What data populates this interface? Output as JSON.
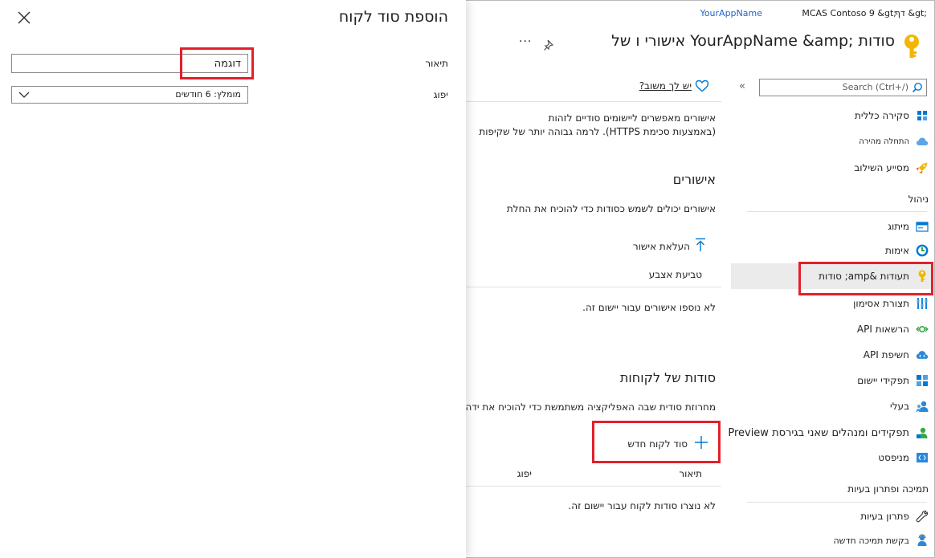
{
  "breadcrumb": {
    "item1": "דף &gt;",
    "item2": "MCAS Contoso 9 &gt;",
    "item3": "YourAppName"
  },
  "page": {
    "title": "אישורי ו של YourAppName &amp; סודות",
    "more_label": "..."
  },
  "search": {
    "placeholder": "Search (Ctrl+/)"
  },
  "feedback": {
    "label": "יש לך משוב?"
  },
  "sidebar": {
    "items": [
      {
        "label": "סקירה כללית",
        "icon": "grid-icon"
      },
      {
        "label": "התחלה מהירה",
        "icon": "cloud-icon"
      },
      {
        "label": "מסייע השילוב",
        "icon": "rocket-icon"
      }
    ],
    "section_manage": "ניהול",
    "manage_items": [
      {
        "label": "מיתוג",
        "icon": "branding-icon"
      },
      {
        "label": "אימות",
        "icon": "authentication-icon"
      },
      {
        "label": "תעודות &amp; סודות",
        "icon": "key-icon"
      },
      {
        "label": "תצורת אסימון",
        "icon": "token-icon"
      },
      {
        "label": "הרשאות API",
        "icon": "api-permissions-icon"
      },
      {
        "label": "חשיפת API",
        "icon": "cloud-api-icon"
      },
      {
        "label": "תפקידי יישום",
        "icon": "app-roles-icon"
      },
      {
        "label": "בעלי",
        "icon": "owners-icon"
      },
      {
        "label": "תפקידים ומנהלים שאני בגירסת Preview",
        "icon": "roles-admins-icon"
      },
      {
        "label": "מניפסט",
        "icon": "manifest-icon"
      }
    ],
    "section_support": "תמיכה ופתרון בעיות",
    "support_items": [
      {
        "label": "פתרון בעיות",
        "icon": "wrench-icon"
      },
      {
        "label": "בקשת תמיכה חדשה",
        "icon": "support-person-icon"
      }
    ]
  },
  "intro": {
    "line1": "אישורים מאפשרים ליישומים סודיים לזהות",
    "line2": "(באמצעות סכימת HTTPS). לרמה גבוהה יותר של שקיפות"
  },
  "certificates": {
    "heading": "אישורים",
    "description": "אישורים יכולים לשמש כסודות כדי להוכיח את החלת",
    "upload_label": "העלאת אישור",
    "col_thumbprint": "טביעת אצבע",
    "empty": "לא נוספו אישורים עבור יישום זה."
  },
  "client_secrets": {
    "heading": "סודות של לקוחות",
    "description": "מחרוזת סודית שבה האפליקציה משתמשת כדי להוכיח את ידה",
    "new_label": "סוד לקוח חדש",
    "col_description": "תיאור",
    "col_expires": "יפוג",
    "empty": "לא נוצרו סודות לקוח עבור יישום זה."
  },
  "blade": {
    "title": "הוספת סוד לקוח",
    "description_label": "תיאור",
    "description_value": "דוגמה",
    "expires_label": "יפוג",
    "expires_value": "מומלץ: 6 חודשים"
  },
  "colors": {
    "accent_blue": "#0078d4",
    "link_blue": "#2166c4",
    "highlight_red": "#e3202a",
    "key_yellow": "#f2b600"
  }
}
